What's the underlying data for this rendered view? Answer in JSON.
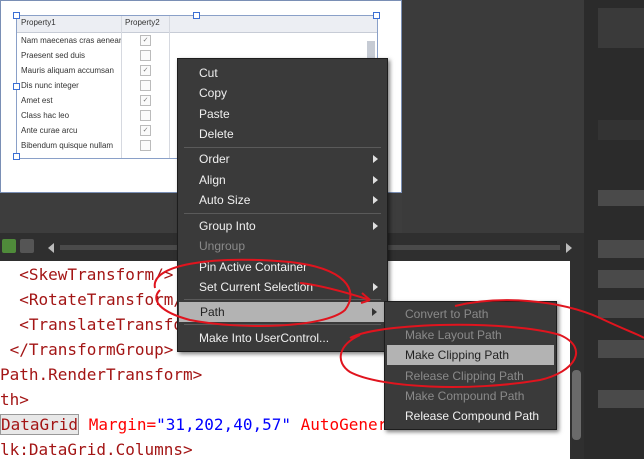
{
  "grid": {
    "headers": [
      "Property1",
      "Property2"
    ],
    "rows": [
      {
        "text": "Nam maecenas cras aenean",
        "checked": "✓"
      },
      {
        "text": "Praesent sed duis",
        "checked": ""
      },
      {
        "text": "Mauris aliquam accumsan",
        "checked": "✓"
      },
      {
        "text": "Dis nunc integer",
        "checked": ""
      },
      {
        "text": "Amet est",
        "checked": "✓"
      },
      {
        "text": "Class hac leo",
        "checked": ""
      },
      {
        "text": "Ante curae arcu",
        "checked": "✓"
      },
      {
        "text": "Bibendum quisque nullam",
        "checked": ""
      }
    ]
  },
  "code_lines": [
    {
      "tag": "  <SkewTransform/>"
    },
    {
      "tag": "  <RotateTransform/>"
    },
    {
      "tag": "  <TranslateTransform/>"
    },
    {
      "tag": " </TransformGroup>"
    },
    {
      "tag": "Path.RenderTransform>"
    },
    {
      "tag": "th>"
    },
    {
      "tag": "DataGrid",
      "attr1": " Margin=",
      "val1": "\"31,202,40,57\"",
      "attr2": " AutoGenerateColumns="
    },
    {
      "tag": "lk:DataGrid.Columns>"
    }
  ],
  "context_menu": {
    "items": [
      {
        "label": "Cut"
      },
      {
        "label": "Copy"
      },
      {
        "label": "Paste"
      },
      {
        "label": "Delete"
      },
      {
        "label": "Order"
      },
      {
        "label": "Align"
      },
      {
        "label": "Auto Size"
      },
      {
        "label": "Group Into"
      },
      {
        "label": "Ungroup"
      },
      {
        "label": "Pin Active Container"
      },
      {
        "label": "Set Current Selection"
      },
      {
        "label": "Path"
      },
      {
        "label": "Make Into UserControl..."
      }
    ]
  },
  "path_submenu": {
    "items": [
      {
        "label": "Convert to Path"
      },
      {
        "label": "Make Layout Path"
      },
      {
        "label": "Make Clipping Path"
      },
      {
        "label": "Release Clipping Path"
      },
      {
        "label": "Make Compound Path"
      },
      {
        "label": "Release Compound Path"
      }
    ]
  },
  "colors": {
    "menu_bg": "#3a3a3a",
    "highlight": "#b3b3b3",
    "annotation_red": "#e0141e"
  }
}
